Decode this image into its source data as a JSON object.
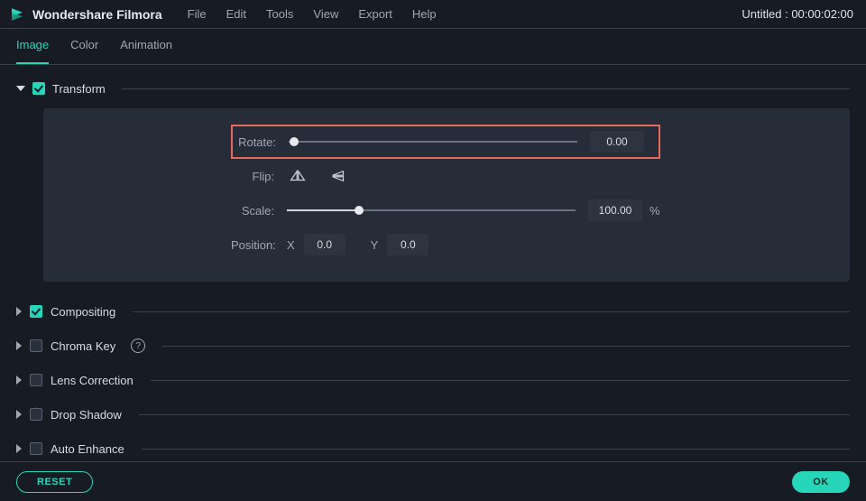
{
  "app": {
    "title": "Wondershare Filmora",
    "project_title": "Untitled : 00:00:02:00"
  },
  "menu": [
    "File",
    "Edit",
    "Tools",
    "View",
    "Export",
    "Help"
  ],
  "tabs": {
    "items": [
      "Image",
      "Color",
      "Animation"
    ],
    "active_index": 0
  },
  "transform": {
    "title": "Transform",
    "rotate_label": "Rotate:",
    "rotate_value": "0.00",
    "rotate_percent": 0,
    "flip_label": "Flip:",
    "scale_label": "Scale:",
    "scale_value": "100.00",
    "scale_percent": 25,
    "scale_unit": "%",
    "position_label": "Position:",
    "pos_x_label": "X",
    "pos_x_value": "0.0",
    "pos_y_label": "Y",
    "pos_y_value": "0.0"
  },
  "sections": [
    {
      "title": "Compositing",
      "checked": true,
      "help": false
    },
    {
      "title": "Chroma Key",
      "checked": false,
      "help": true
    },
    {
      "title": "Lens Correction",
      "checked": false,
      "help": false
    },
    {
      "title": "Drop Shadow",
      "checked": false,
      "help": false
    },
    {
      "title": "Auto Enhance",
      "checked": false,
      "help": false
    }
  ],
  "footer": {
    "reset": "RESET",
    "ok": "OK"
  }
}
